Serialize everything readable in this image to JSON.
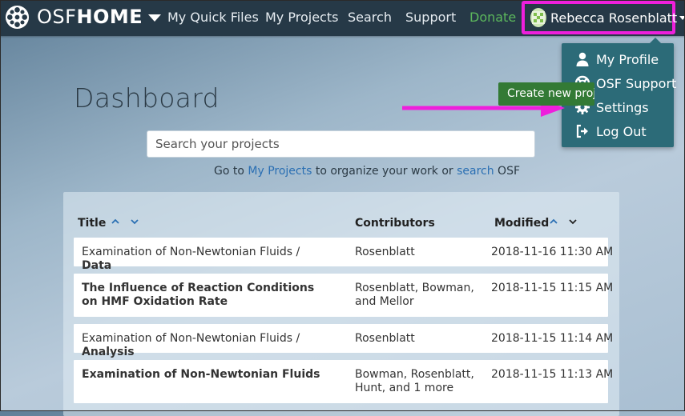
{
  "brand": {
    "osf": "OSF",
    "home": "HOME"
  },
  "nav": {
    "quick_files": "My Quick Files",
    "projects": "My Projects",
    "search": "Search",
    "support": "Support",
    "donate": "Donate"
  },
  "user": {
    "name": "Rebecca Rosenblatt"
  },
  "dropdown": {
    "profile": "My Profile",
    "support": "OSF Support",
    "settings": "Settings",
    "logout": "Log Out"
  },
  "dashboard": {
    "title": "Dashboard",
    "create_button": "Create new project",
    "search_placeholder": "Search your projects",
    "goto_prefix": "Go to ",
    "goto_link1": "My Projects",
    "goto_middle": " to organize your work or ",
    "goto_link2": "search",
    "goto_suffix": " OSF"
  },
  "table": {
    "headers": {
      "title": "Title",
      "contributors": "Contributors",
      "modified": "Modified"
    },
    "rows": [
      {
        "title_prefix": "Examination of Non-Newtonian Fluids / ",
        "title_bold": "Data",
        "contributors": "Rosenblatt",
        "modified": "2018-11-16 11:30 AM"
      },
      {
        "title_prefix": "",
        "title_bold": "The Influence of Reaction Conditions on HMF Oxidation Rate",
        "contributors": "Rosenblatt, Bowman, and Mellor",
        "modified": "2018-11-15 11:15 AM"
      },
      {
        "title_prefix": "Examination of Non-Newtonian Fluids / ",
        "title_bold": "Analysis",
        "contributors": "Rosenblatt",
        "modified": "2018-11-15 11:14 AM"
      },
      {
        "title_prefix": "",
        "title_bold": "Examination of Non-Newtonian Fluids",
        "contributors": "Bowman, Rosenblatt, Hunt, and 1 more",
        "modified": "2018-11-15 11:13 AM"
      }
    ]
  },
  "colors": {
    "navbar": "#263947",
    "dropdown": "#2c6b78",
    "highlight": "#ee1fdc",
    "create": "#337a35",
    "donate": "#5cb85c",
    "link": "#2a6fb3"
  }
}
